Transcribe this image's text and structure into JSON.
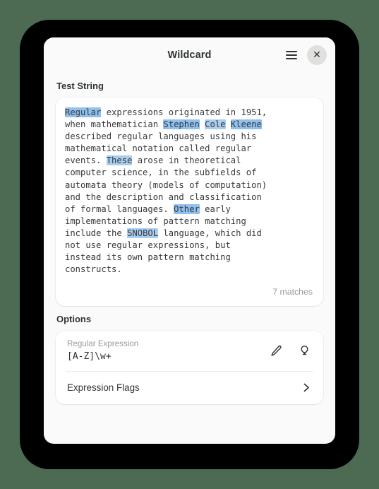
{
  "window": {
    "title": "Wildcard",
    "menu_button": "menu-icon",
    "close_button": "✕"
  },
  "test_string": {
    "section_title": "Test String",
    "segments": [
      {
        "text": "Regular",
        "highlight": "active"
      },
      {
        "text": " expressions originated in 1951,\nwhen mathematician ",
        "highlight": "none"
      },
      {
        "text": "Stephen",
        "highlight": "active"
      },
      {
        "text": " ",
        "highlight": "none"
      },
      {
        "text": "Cole",
        "highlight": "normal"
      },
      {
        "text": " ",
        "highlight": "none"
      },
      {
        "text": "Kleene",
        "highlight": "active"
      },
      {
        "text": "\ndescribed regular languages using his\nmathematical notation called regular\nevents. ",
        "highlight": "none"
      },
      {
        "text": "These",
        "highlight": "normal"
      },
      {
        "text": " arose in theoretical\ncomputer science, in the subfields of\nautomata theory (models of computation)\nand the description and classification\nof formal languages. ",
        "highlight": "none"
      },
      {
        "text": "Other",
        "highlight": "active"
      },
      {
        "text": " early\nimplementations of pattern matching\ninclude the ",
        "highlight": "none"
      },
      {
        "text": "SNOBOL",
        "highlight": "normal"
      },
      {
        "text": " language, which did\nnot use regular expressions, but\ninstead its own pattern matching\nconstructs.",
        "highlight": "none"
      }
    ],
    "full_text": "Regular expressions originated in 1951, when mathematician Stephen Cole Kleene described regular languages using his mathematical notation called regular events. These arose in theoretical computer science, in the subfields of automata theory (models of computation) and the description and classification of formal languages. Other early implementations of pattern matching include the SNOBOL language, which did not use regular expressions, but instead its own pattern matching constructs.",
    "match_count": "7 matches"
  },
  "options": {
    "section_title": "Options",
    "regex": {
      "label": "Regular Expression",
      "value": "[A-Z]\\w+",
      "edit_icon": "pencil-icon",
      "hint_icon": "lightbulb-icon"
    },
    "flags": {
      "label": "Expression Flags",
      "chevron": "chevron-right-icon"
    }
  },
  "colors": {
    "highlight": "#a9cdef",
    "highlight_active": "#8fc0ee",
    "window_bg": "#fafafa",
    "card_bg": "#ffffff",
    "text": "#2e3436",
    "muted": "#9a9996",
    "desktop_bg": "#4d6a53",
    "frame": "#000000"
  }
}
